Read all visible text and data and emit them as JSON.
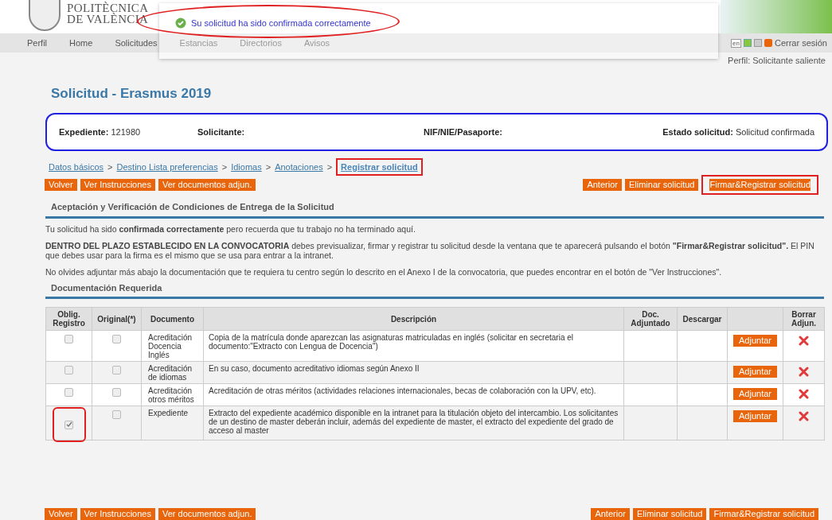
{
  "header": {
    "logo_lines": [
      "POLITÈCNICA",
      "DE VALÈNCIA"
    ],
    "nav": [
      "Perfil",
      "Home",
      "Solicitudes",
      "Estancias",
      "Directorios",
      "Avisos"
    ],
    "languages": [
      {
        "label": "en",
        "selected": false
      }
    ],
    "logout": "Cerrar sesión",
    "profile": "Perfil: Solicitante saliente"
  },
  "notification": {
    "message": "Su solicitud ha sido confirmada correctamente",
    "highlighted": true
  },
  "title": "Solicitud - Erasmus 2019",
  "info": [
    {
      "label": "Expediente:",
      "value": "121980"
    },
    {
      "label": "Solicitante:"
    },
    {
      "label": "NIF/NIE/Pasaporte:"
    },
    {
      "label": "Estado solicitud:",
      "value": "Solicitud confirmada"
    }
  ],
  "breadcrumb": [
    {
      "label": "Datos básicos",
      "selected": false,
      "highlighted": false
    },
    {
      "label": "Destino Lista preferencias",
      "selected": false,
      "highlighted": false
    },
    {
      "label": "Idiomas",
      "selected": false,
      "highlighted": false
    },
    {
      "label": "Anotaciones",
      "selected": false,
      "highlighted": false
    },
    {
      "label": "Registrar solicitud",
      "selected": true,
      "highlighted": true
    }
  ],
  "breadcrumb_separators": [
    ">",
    ">",
    ">",
    ">"
  ],
  "buttons_left": [
    {
      "label": "Volver",
      "highlighted": false
    },
    {
      "label": "Ver Instrucciones",
      "highlighted": false
    },
    {
      "label": "Ver documentos adjun.",
      "highlighted": false
    }
  ],
  "buttons_right": [
    {
      "label": "Anterior",
      "highlighted": false
    },
    {
      "label": "Eliminar solicitud",
      "highlighted": false
    },
    {
      "label": "Firmar&Registrar solicitud",
      "highlighted": true
    }
  ],
  "section_1": {
    "heading": "Aceptación y Verificación de Condiciones de Entrega de la Solicitud",
    "paragraphs": [
      "Tu solicitud ha sido **confirmada correctamente** pero recuerda que tu trabajo no ha terminado aquí.",
      "**DENTRO DEL PLAZO ESTABLECIDO EN LA CONVOCATORIA** debes previsualizar, firmar y registrar tu solicitud desde la ventana que te aparecerá pulsando el botón **\"Firmar&Registrar solicitud\".** El PIN que debes usar para la firma es el mismo que se usa para entrar a la intranet.",
      "No olvides adjuntar más abajo la documentación que te requiera tu centro según lo descrito en el Anexo I de la convocatoria, que puedes encontrar en el botón de \"Ver Instrucciones\"."
    ]
  },
  "section_2": {
    "heading": "Documentación Requerida"
  },
  "table": {
    "columns": [
      "Oblig. Registro",
      "Original(*)",
      "Documento",
      "Descripción",
      "Doc. Adjuntado",
      "Descargar",
      "",
      "Borrar Adjun."
    ],
    "rows": [
      {
        "oblig_checked": false,
        "oblig_highlighted": false,
        "original_checked": false,
        "document": "Acreditación Docencia Inglés",
        "description": "Copia de la matrícula donde aparezcan las asignaturas matriculadas en inglés (solicitar en secretaria el documento:\"Extracto con Lengua de Docencia\")",
        "action": "Adjuntar"
      },
      {
        "oblig_checked": false,
        "oblig_highlighted": false,
        "original_checked": false,
        "document": "Acreditación de idiomas",
        "description": "En su caso, documento acreditativo idiomas según Anexo II",
        "action": "Adjuntar"
      },
      {
        "oblig_checked": false,
        "oblig_highlighted": false,
        "original_checked": false,
        "document": "Acreditación otros méritos",
        "description": "Acreditación de otras méritos (actividades relaciones internacionales, becas de colaboración con la UPV, etc).",
        "action": "Adjuntar"
      },
      {
        "oblig_checked": true,
        "oblig_highlighted": true,
        "original_checked": false,
        "document": "Expediente",
        "description": "Extracto del expediente académico disponible en la intranet para la titulación objeto del intercambio. Los solicitantes de un destino de master deberán incluir, además del expediente de master, el extracto del expediente del grado de acceso al master",
        "action": "Adjuntar"
      }
    ]
  },
  "bottom_buttons_left": [
    {
      "label": "Volver"
    },
    {
      "label": "Ver Instrucciones"
    },
    {
      "label": "Ver documentos adjun."
    }
  ],
  "bottom_buttons_right": [
    {
      "label": "Anterior"
    },
    {
      "label": "Eliminar solicitud"
    },
    {
      "label": "Firmar&Registrar solicitud"
    }
  ]
}
